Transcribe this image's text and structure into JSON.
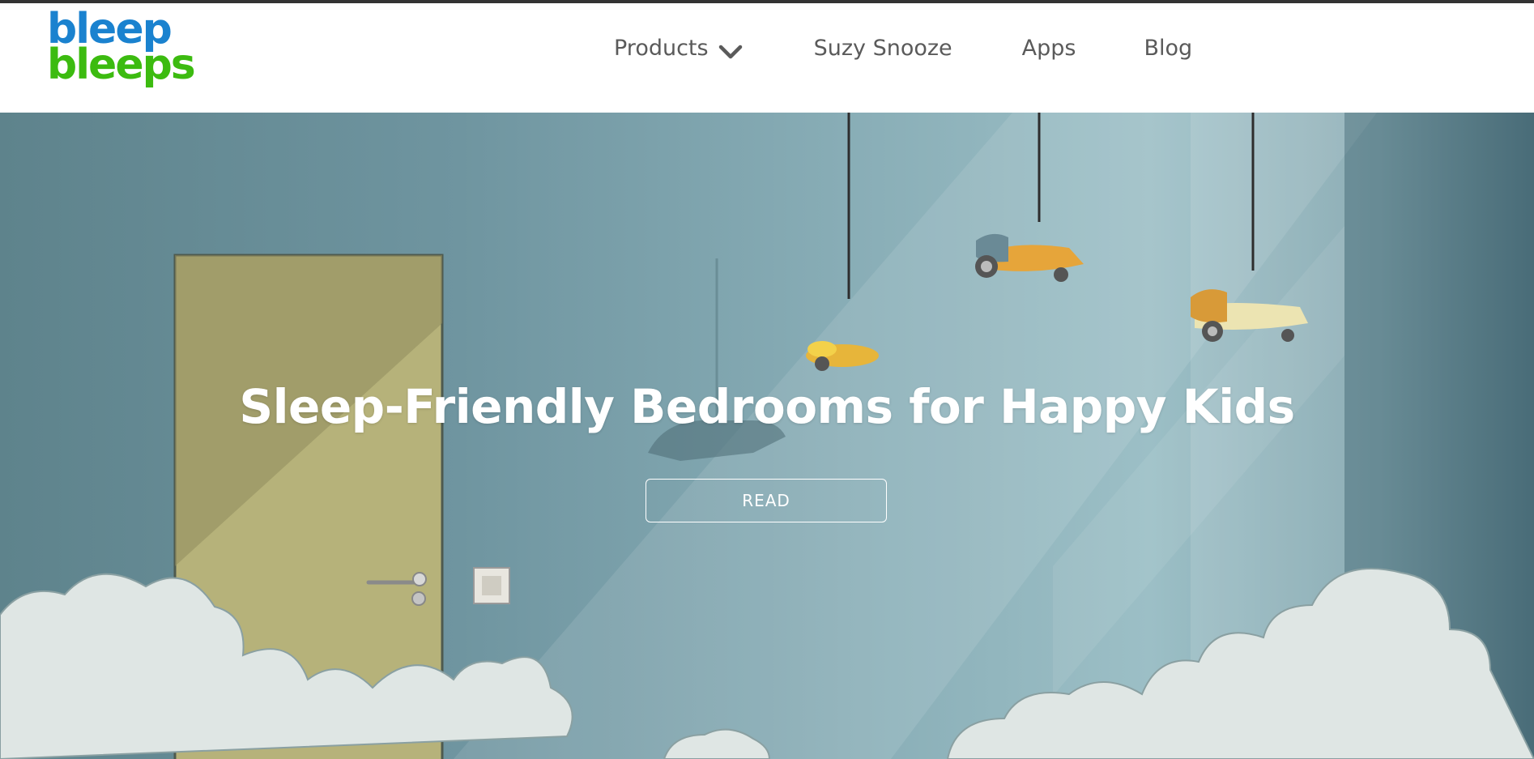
{
  "logo": {
    "line1": "bleep",
    "line2": "bleeps",
    "color_line1": "#1a82cf",
    "color_line2": "#3cbb10"
  },
  "nav": {
    "items": [
      {
        "label": "Products",
        "has_dropdown": true,
        "icon": "chevron-down-icon"
      },
      {
        "label": "Suzy Snooze"
      },
      {
        "label": "Apps"
      },
      {
        "label": "Blog"
      }
    ]
  },
  "hero": {
    "title": "Sleep-Friendly Bedrooms for Happy Kids",
    "button_label": "READ"
  },
  "colors": {
    "nav_text": "#5a5a5a",
    "hero_text": "#ffffff",
    "top_line": "#333333"
  }
}
